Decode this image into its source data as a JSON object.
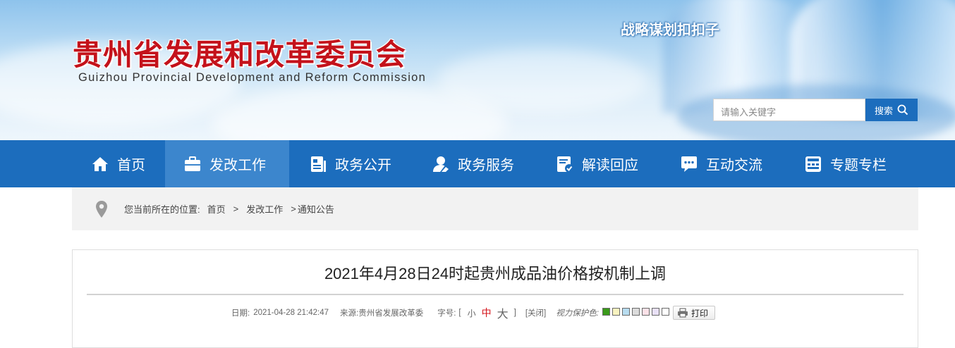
{
  "header": {
    "title": "贵州省发展和改革委员会",
    "subtitle": "Guizhou Provincial Development and Reform Commission",
    "slogan": "战略谋划扣扣子",
    "search": {
      "placeholder": "请输入关键字",
      "button_label": "搜索"
    }
  },
  "nav": {
    "items": [
      {
        "label": "首页",
        "icon": "home-icon"
      },
      {
        "label": "发改工作",
        "icon": "briefcase-icon",
        "active": true
      },
      {
        "label": "政务公开",
        "icon": "document-list-icon"
      },
      {
        "label": "政务服务",
        "icon": "service-user-icon"
      },
      {
        "label": "解读回应",
        "icon": "document-edit-icon"
      },
      {
        "label": "互动交流",
        "icon": "chat-bubble-icon"
      },
      {
        "label": "专题专栏",
        "icon": "panel-icon"
      }
    ],
    "active_color": "#3c86cd",
    "bar_color": "#1c6dbd"
  },
  "breadcrumb": {
    "prefix": "您当前所在的位置:",
    "items": [
      "首页",
      "发改工作",
      "通知公告"
    ],
    "separator": ">",
    "icon": "location-pin-icon"
  },
  "article": {
    "title": "2021年4月28日24时起贵州成品油价格按机制上调",
    "date_label": "日期:",
    "date": "2021-04-28 21:42:47",
    "source_label": "来源:",
    "source": "贵州省发展改革委",
    "font_size_label": "字号:",
    "bracket_open": "[",
    "bracket_close": "]",
    "font_sizes": [
      "小",
      "中",
      "大"
    ],
    "close_label": "[关闭]",
    "vision_label": "视力保护色:",
    "vision_colors": [
      "#3a9a1a",
      "#f8f3c0",
      "#b8ddf0",
      "#dcdcdc",
      "#fce2e8",
      "#e9e1f7",
      "#ffffff"
    ],
    "print_label": "打印"
  }
}
